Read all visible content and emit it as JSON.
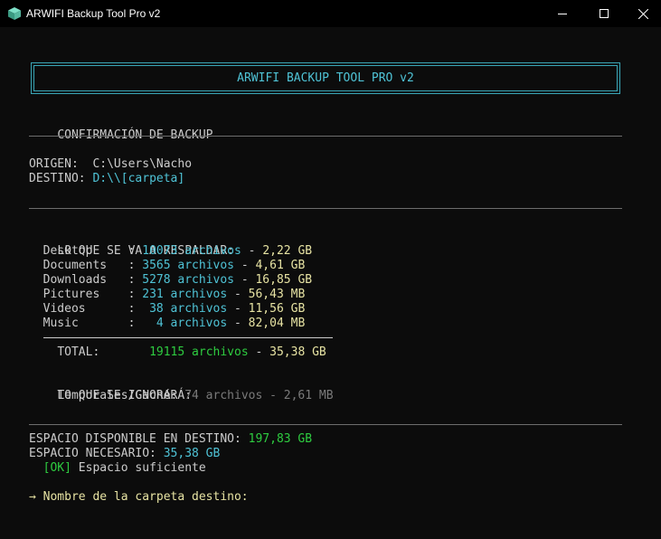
{
  "window": {
    "title": "ARWIFI Backup Tool Pro v2",
    "controls": {
      "minimize": "—",
      "maximize": "☐",
      "close": "✕"
    }
  },
  "banner": {
    "text": "ARWIFI BACKUP TOOL PRO v2"
  },
  "header": {
    "text": "CONFIRMACIÓN DE BACKUP"
  },
  "paths": {
    "origin_label": "ORIGEN:",
    "origin_value": "C:\\Users\\Nacho",
    "dest_label": "DESTINO:",
    "dest_value": "D:\\\\[carpeta]"
  },
  "backup": {
    "heading": "LO QUE SE VA A RESPALDAR:",
    "items": [
      {
        "name": "Desktop",
        "count": "10073 archivos",
        "size": "2,22 GB"
      },
      {
        "name": "Documents",
        "count": "3565 archivos",
        "size": "4,61 GB"
      },
      {
        "name": "Downloads",
        "count": "5278 archivos",
        "size": "16,85 GB"
      },
      {
        "name": "Pictures",
        "count": "231 archivos",
        "size": "56,43 MB"
      },
      {
        "name": "Videos",
        "count": "38 archivos",
        "size": "11,56 GB"
      },
      {
        "name": "Music",
        "count": "4 archivos",
        "size": "82,04 MB"
      }
    ],
    "total_label": "TOTAL:",
    "total_count": "19115 archivos",
    "total_size": "35,38 GB"
  },
  "ignored": {
    "heading": "LO QUE SE IGNORARÁ:",
    "label": "Temporales/Caché:",
    "count": "74 archivos",
    "size": "2,61 MB"
  },
  "space": {
    "available_label": "ESPACIO DISPONIBLE EN DESTINO:",
    "available_value": "197,83 GB",
    "needed_label": "ESPACIO NECESARIO:",
    "needed_value": "35,38 GB",
    "ok_tag": "[OK]",
    "ok_text": "Espacio suficiente"
  },
  "prompt": {
    "arrow": "→",
    "text": "Nombre de la carpeta destino:"
  },
  "colors": {
    "background": "#0c0c0c",
    "cyan": "#4fc3d6",
    "yellow": "#e7e3a3",
    "green": "#2ecc40",
    "gray": "#7a7a7a"
  }
}
